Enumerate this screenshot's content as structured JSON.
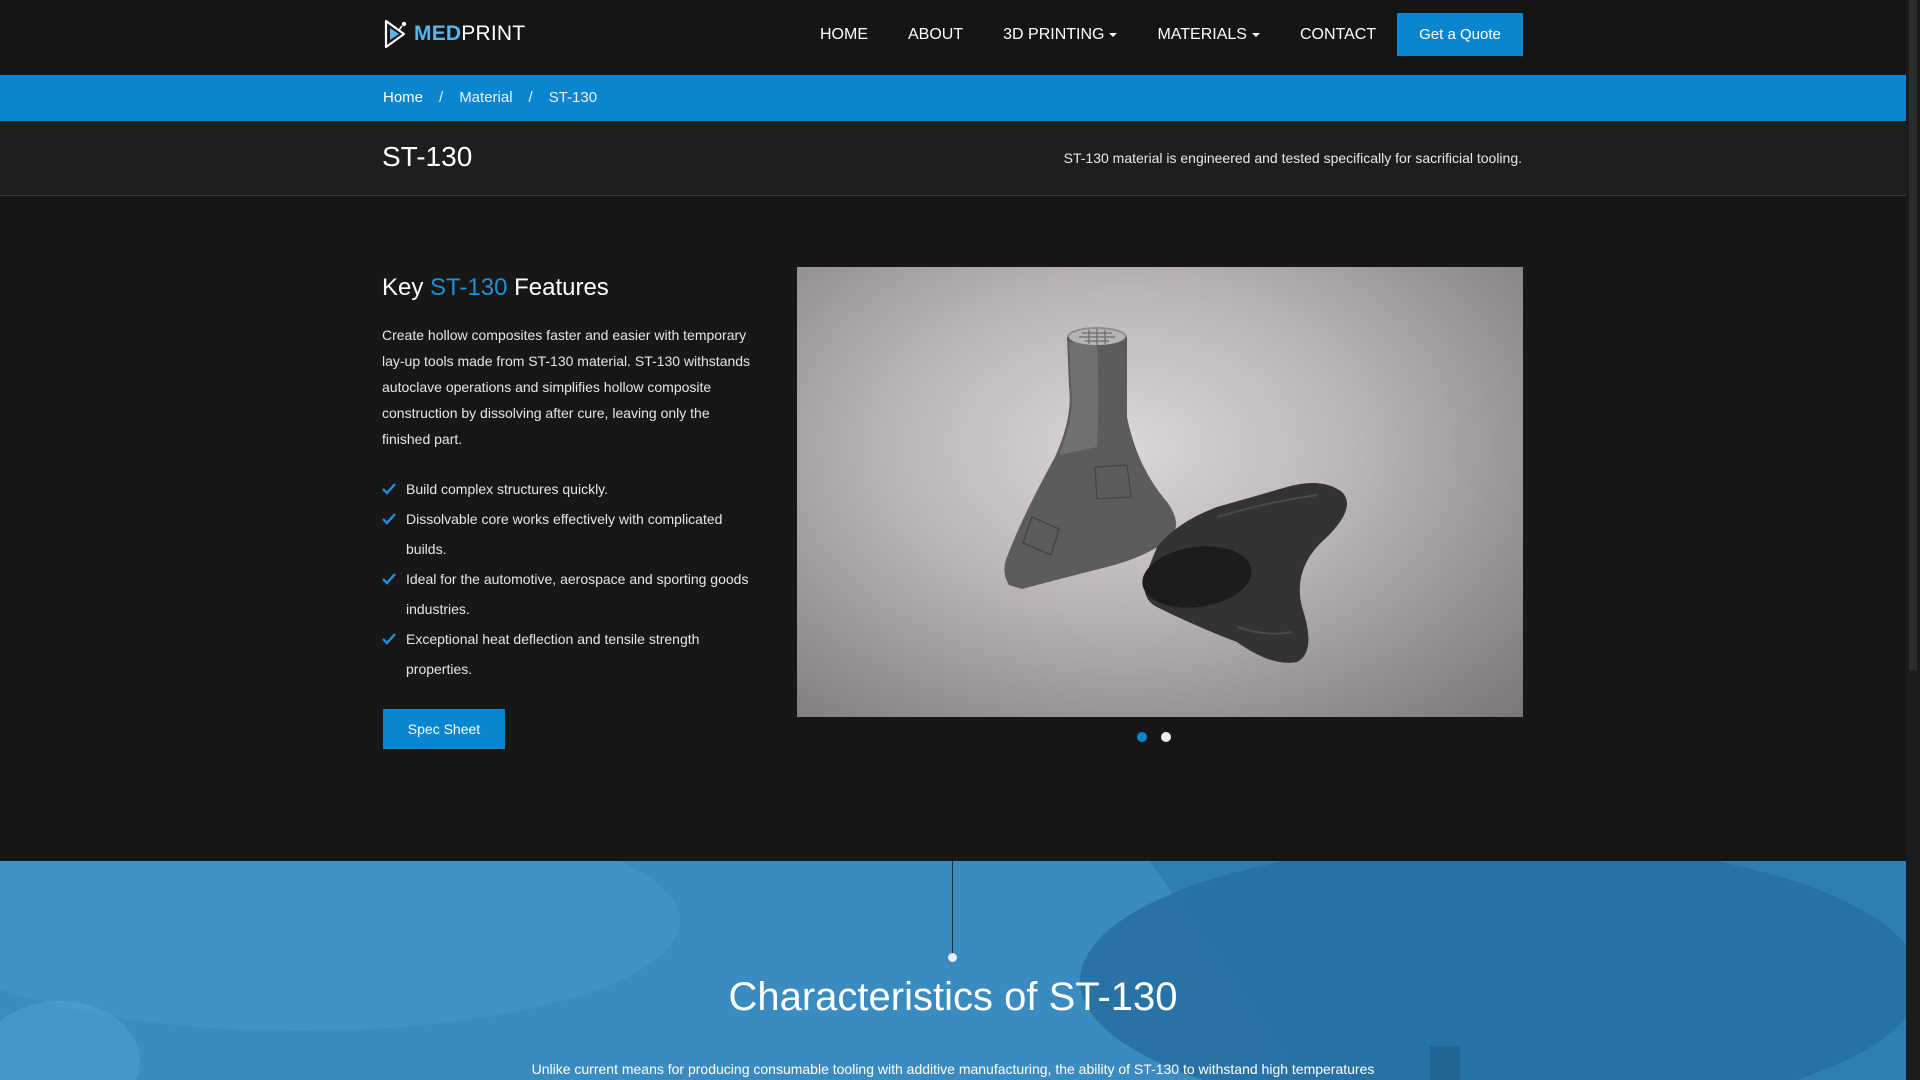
{
  "brand": {
    "logo_med": "MED",
    "logo_print": "PRINT",
    "accent_color": "#0a86d1",
    "logo_icon": "printer-mark-icon"
  },
  "nav": {
    "items": [
      {
        "label": "HOME",
        "has_dropdown": false
      },
      {
        "label": "ABOUT",
        "has_dropdown": false
      },
      {
        "label": "3D PRINTING",
        "has_dropdown": true
      },
      {
        "label": "MATERIALS",
        "has_dropdown": true
      },
      {
        "label": "CONTACT",
        "has_dropdown": false
      }
    ],
    "cta_label": "Get a Quote"
  },
  "breadcrumb": {
    "items": [
      "Home",
      "Material",
      "ST-130"
    ],
    "separator": "/"
  },
  "title_band": {
    "title": "ST-130",
    "tagline": "ST-130 material is engineered and tested specifically for sacrificial tooling."
  },
  "features": {
    "heading_prefix": "Key",
    "heading_accent": "ST-130",
    "heading_suffix": "Features",
    "body": "Create hollow composites faster and easier with temporary lay-up tools made from ST-130 material. ST-130 withstands autoclave operations and simplifies hollow composite construction by dissolving after cure, leaving only the finished part.",
    "bullets": [
      "Build complex structures quickly.",
      "Dissolvable core works effectively with complicated builds.",
      "Ideal for the automotive, aerospace and sporting goods industries.",
      "Exceptional heat deflection and tensile strength properties."
    ],
    "bullet_icon": "checkmark-icon",
    "spec_button": "Spec Sheet"
  },
  "carousel": {
    "slide_count": 2,
    "active_index": 0
  },
  "characteristics": {
    "title": "Characteristics of ST-130",
    "body": "Unlike current means for producing consumable tooling with additive manufacturing, the ability of ST-130 to withstand high temperatures"
  }
}
